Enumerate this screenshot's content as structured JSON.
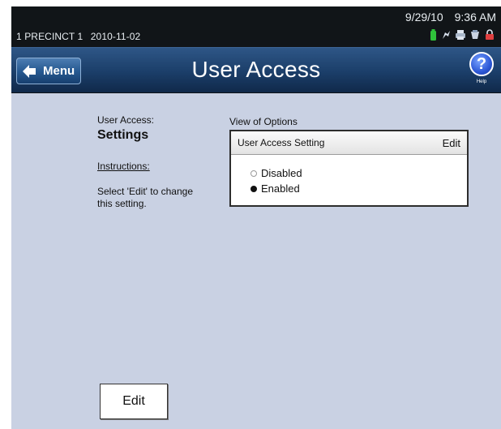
{
  "status": {
    "precinct": "1 PRECINCT 1",
    "election_date": "2010-11-02",
    "date": "9/29/10",
    "time": "9:36 AM",
    "icons": [
      "battery-icon",
      "power-plug-icon",
      "printer-icon",
      "memory-card-icon",
      "lock-icon"
    ]
  },
  "header": {
    "menu_label": "Menu",
    "title": "User Access",
    "help_symbol": "?",
    "help_label": "Help"
  },
  "main": {
    "setting_label": "User Access:",
    "setting_value": "Settings",
    "instructions_label": "Instructions:",
    "instructions_text": "Select 'Edit' to change this setting.",
    "options_label": "View of Options",
    "options_header": "User Access Setting",
    "options_edit": "Edit",
    "options": [
      {
        "label": "Disabled",
        "selected": false
      },
      {
        "label": "Enabled",
        "selected": true
      }
    ],
    "edit_button": "Edit"
  },
  "colors": {
    "header_blue": "#1b3e69",
    "content_bg": "#c9d1e3",
    "battery_green": "#2fc23a"
  }
}
